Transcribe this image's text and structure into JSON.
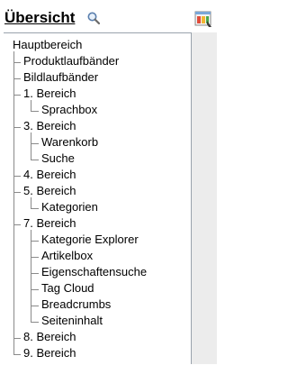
{
  "header": {
    "title": "Übersicht"
  },
  "icons": {
    "search": "search-icon",
    "app": "window-app-icon"
  },
  "tree": {
    "root": "Hauptbereich",
    "items": [
      {
        "label": "Produktlaufbänder"
      },
      {
        "label": "Bildlaufbänder"
      },
      {
        "label": "1. Bereich",
        "children": [
          {
            "label": "Sprachbox"
          }
        ]
      },
      {
        "label": "3. Bereich",
        "children": [
          {
            "label": "Warenkorb"
          },
          {
            "label": "Suche"
          }
        ]
      },
      {
        "label": "4. Bereich"
      },
      {
        "label": "5. Bereich",
        "children": [
          {
            "label": "Kategorien"
          }
        ]
      },
      {
        "label": "7. Bereich",
        "children": [
          {
            "label": "Kategorie Explorer"
          },
          {
            "label": "Artikelbox"
          },
          {
            "label": "Eigenschaftensuche"
          },
          {
            "label": "Tag Cloud"
          },
          {
            "label": "Breadcrumbs"
          },
          {
            "label": "Seiteninhalt"
          }
        ]
      },
      {
        "label": "8. Bereich"
      },
      {
        "label": "9. Bereich"
      }
    ]
  },
  "colors": {
    "border": "#9aa3ad",
    "strip": "#ececec",
    "connector": "#8a8a8a"
  }
}
